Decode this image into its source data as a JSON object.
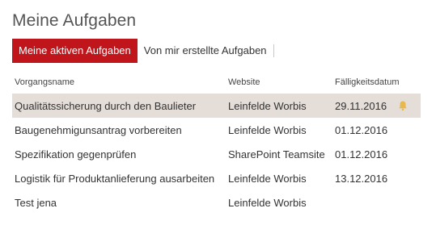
{
  "title": "Meine Aufgaben",
  "tabs": [
    {
      "label": "Meine aktiven Aufgaben"
    },
    {
      "label": "Von mir erstellte Aufgaben"
    }
  ],
  "columns": {
    "name": "Vorgangsname",
    "website": "Website",
    "due": "Fälligkeitsdatum"
  },
  "rows": [
    {
      "name": "Qualitätssicherung durch den Baulieter",
      "website": "Leinfelde Worbis",
      "due": "29.11.2016",
      "selected": true,
      "icon": "bell-icon"
    },
    {
      "name": "Baugenehmigunsantrag vorbereiten",
      "website": "Leinfelde Worbis",
      "due": "01.12.2016"
    },
    {
      "name": "Spezifikation gegenprüfen",
      "website": "SharePoint Teamsite",
      "due": "01.12.2016"
    },
    {
      "name": "Logistik für Produktanlieferung ausarbeiten",
      "website": "Leinfelde Worbis",
      "due": "13.12.2016"
    },
    {
      "name": "Test jena",
      "website": "Leinfelde Worbis",
      "due": ""
    }
  ],
  "colors": {
    "accent": "#c1151c",
    "selected_row": "#e4ddd8",
    "bell": "#e8b84a"
  }
}
